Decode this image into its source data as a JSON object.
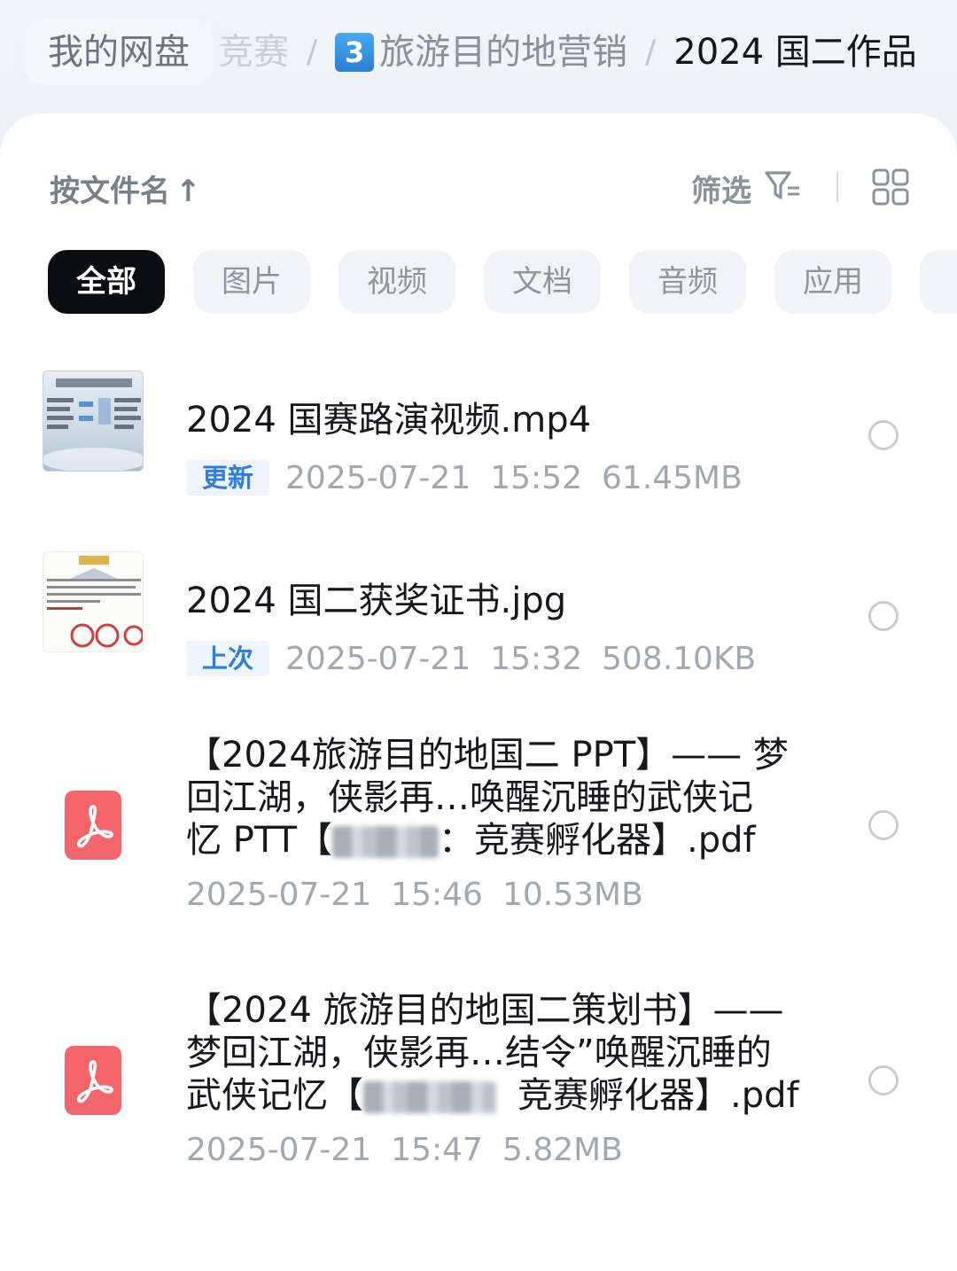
{
  "breadcrumb": {
    "home": "我的网盘",
    "truncated": "竞赛",
    "separator": "/",
    "folder_badge": "3",
    "folder": "旅游目的地营销",
    "current": "2024 国二作品"
  },
  "toolbar": {
    "sort_label": "按文件名",
    "sort_arrow": "↑",
    "filter_label": "筛选",
    "filter_icon": "filter-icon",
    "view_icon": "grid-view-icon"
  },
  "chips": [
    "全部",
    "图片",
    "视频",
    "文档",
    "音频",
    "应用"
  ],
  "files": [
    {
      "name": "2024 国赛路演视频.mp4",
      "tag": "更新",
      "date": "2025-07-21",
      "time": "15:52",
      "size": "61.45MB",
      "thumb": "video-thumbnail"
    },
    {
      "name": "2024 国二获奖证书.jpg",
      "tag": "上次",
      "date": "2025-07-21",
      "time": "15:32",
      "size": "508.10KB",
      "thumb": "certificate-thumbnail"
    },
    {
      "name_line1": "【2024旅游目的地国二 PPT】—— 梦",
      "name_line2": "回江湖，侠影再…唤醒沉睡的武侠记",
      "name_line3_a": "忆 PTT【",
      "name_line3_b": "：竞赛孵化器】.pdf",
      "date": "2025-07-21",
      "time": "15:46",
      "size": "10.53MB",
      "thumb": "pdf-icon"
    },
    {
      "name_line1": "【2024 旅游目的地国二策划书】——",
      "name_line2": "梦回江湖，侠影再…结令”唤醒沉睡的",
      "name_line3_a": "武侠记忆【",
      "name_line3_b": "竞赛孵化器】.pdf",
      "date": "2025-07-21",
      "time": "15:47",
      "size": "5.82MB",
      "thumb": "pdf-icon"
    }
  ],
  "colors": {
    "accent": "#2f7de1",
    "pdf_red": "#f3646b",
    "active_chip": "#0c0d10"
  }
}
